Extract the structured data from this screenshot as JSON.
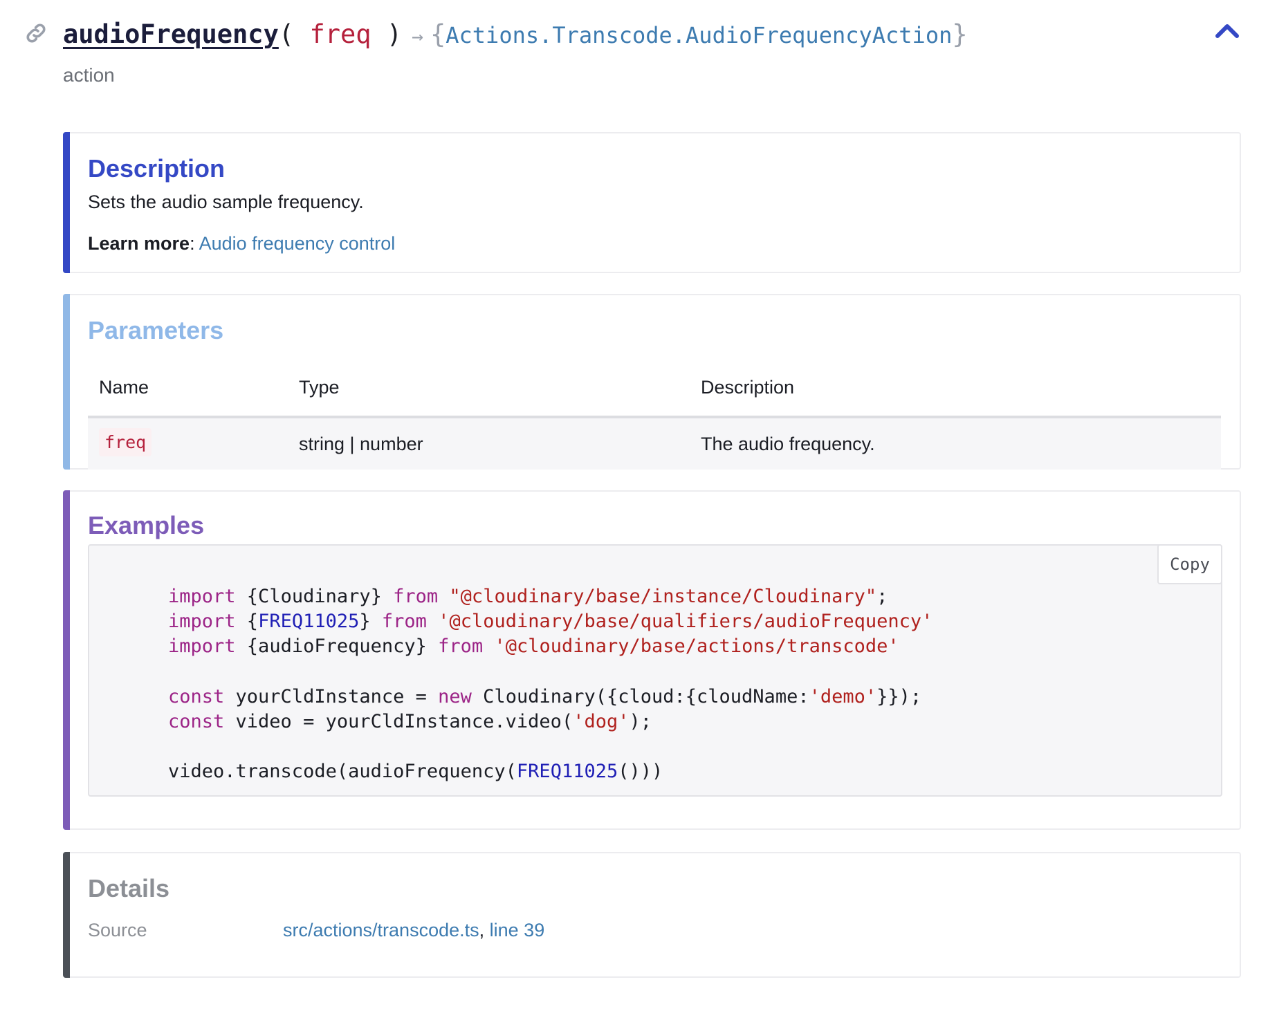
{
  "header": {
    "function_name": "audioFrequency",
    "open_paren": "(",
    "param": "freq",
    "close_paren": ")",
    "arrow": "→",
    "return_open": "{",
    "return_type": "Actions.Transcode.AudioFrequencyAction",
    "return_close": "}",
    "kind": "action"
  },
  "description": {
    "title": "Description",
    "text": "Sets the audio sample frequency.",
    "learn_more_label": "Learn more",
    "learn_more_sep": ":",
    "learn_more_link": "Audio frequency control"
  },
  "parameters": {
    "title": "Parameters",
    "columns": [
      "Name",
      "Type",
      "Description"
    ],
    "rows": [
      {
        "name": "freq",
        "type": "string | number",
        "description": "The audio frequency."
      }
    ]
  },
  "examples": {
    "title": "Examples",
    "copy_label": "Copy"
  },
  "details": {
    "title": "Details",
    "source_label": "Source",
    "source_file": "src/actions/transcode.ts",
    "source_sep": ",",
    "source_line": "line 39"
  },
  "colors": {
    "description_accent": "#3448c5",
    "parameters_accent": "#90b8e6",
    "examples_accent": "#7d5cb8",
    "details_accent": "#4b5057",
    "link": "#3d7bb0"
  },
  "icons": {
    "anchor": "link-icon",
    "collapse": "chevron-up-icon"
  }
}
